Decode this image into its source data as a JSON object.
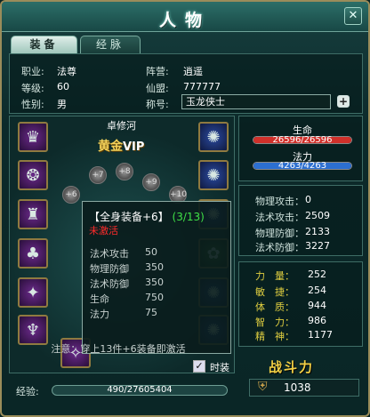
{
  "window": {
    "title": "人物",
    "close_label": "✕"
  },
  "tabs": [
    {
      "label": "装备"
    },
    {
      "label": "经脉"
    }
  ],
  "info": {
    "profession_label": "职业:",
    "profession": "法尊",
    "camp_label": "阵营:",
    "camp": "逍遥",
    "level_label": "等级:",
    "level": "60",
    "guild_label": "仙盟:",
    "guild": "777777",
    "gender_label": "性别:",
    "gender": "男",
    "title_label": "称号:",
    "title_value": "玉龙侠士",
    "add_label": "+"
  },
  "character": {
    "name": "卓修河",
    "vip_gold": "黄金",
    "vip_text": "VIP"
  },
  "enhance_orbs": [
    "+6",
    "+7",
    "+8",
    "+9",
    "+10",
    "+6"
  ],
  "tooltip": {
    "title": "【全身装备+6】",
    "count": "(3/13)",
    "status": "未激活",
    "rows": [
      {
        "k": "法术攻击",
        "v": "50"
      },
      {
        "k": "物理防御",
        "v": "350"
      },
      {
        "k": "法术防御",
        "v": "350"
      },
      {
        "k": "生命",
        "v": "750"
      },
      {
        "k": "法力",
        "v": "75"
      }
    ],
    "note": "注意：穿上13件+6装备即激活"
  },
  "fashion": {
    "check": "✓",
    "label": "时装"
  },
  "vitals": {
    "hp_label": "生命",
    "hp_text": "26596/26596",
    "hp_fraction": 1.0,
    "hp_color": "#d0302a",
    "mp_label": "法力",
    "mp_text": "4263/4263",
    "mp_fraction": 1.0,
    "mp_color": "#2c6fd0"
  },
  "combat_stats": [
    {
      "k": "物理攻击：",
      "v": "0"
    },
    {
      "k": "法术攻击：",
      "v": "2509"
    },
    {
      "k": "物理防御：",
      "v": "2133"
    },
    {
      "k": "法术防御：",
      "v": "3227"
    }
  ],
  "attributes": [
    {
      "k": "力　量：",
      "v": "252"
    },
    {
      "k": "敏　捷：",
      "v": "254"
    },
    {
      "k": "体　质：",
      "v": "944"
    },
    {
      "k": "智　力：",
      "v": "986"
    },
    {
      "k": "精　神：",
      "v": "1177"
    }
  ],
  "power": {
    "label": "战斗力",
    "value": "1038"
  },
  "exp": {
    "label": "经验:",
    "text": "490/27605404"
  },
  "icons": [
    "close-icon",
    "plus-icon",
    "shield-icon",
    "equipment-slot-icon",
    "enhance-orb-icon",
    "check-icon"
  ]
}
